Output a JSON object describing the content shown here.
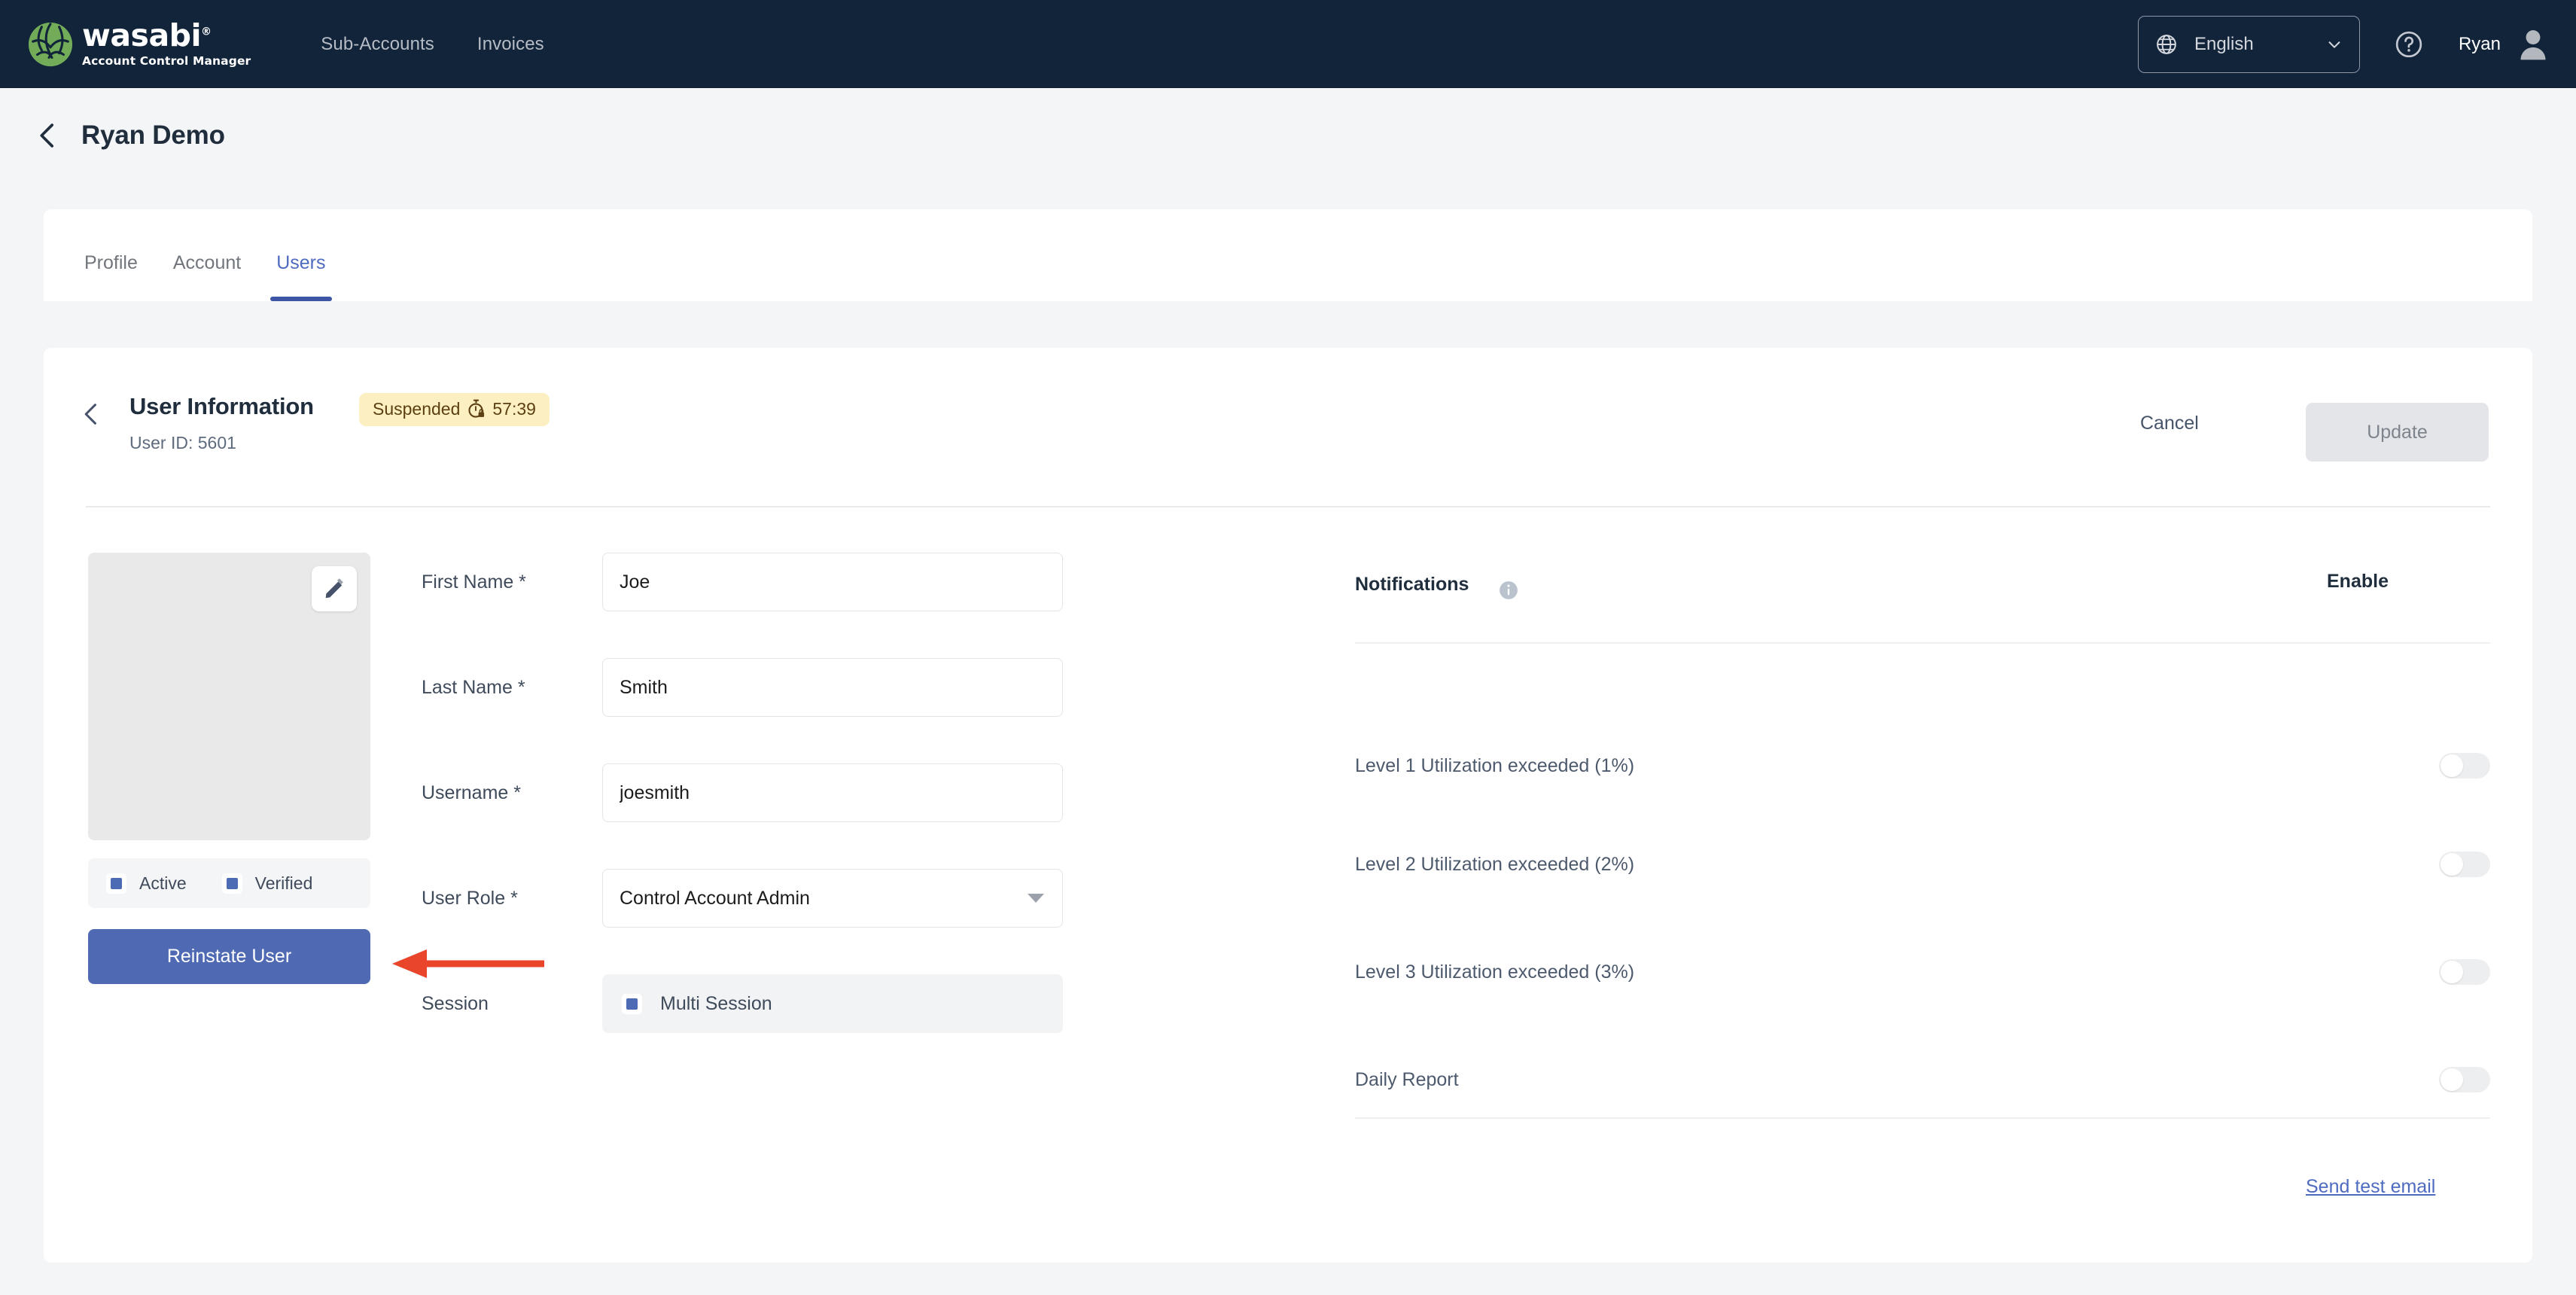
{
  "topnav": {
    "brand_word": "wasabi",
    "brand_sub": "Account Control Manager",
    "links": [
      {
        "label": "Sub-Accounts"
      },
      {
        "label": "Invoices"
      }
    ],
    "language": "English",
    "user_name": "Ryan",
    "icons": {
      "globe": "globe-icon",
      "chevron_down": "chevron-down-icon",
      "help": "help-circle-icon",
      "avatar": "user-avatar-icon"
    },
    "colors": {
      "bar_bg": "#12243a",
      "logo_green": "#72ac58"
    }
  },
  "breadcrumb": {
    "back_icon": "chevron-left-icon",
    "title": "Ryan Demo"
  },
  "tabs": [
    {
      "label": "Profile",
      "active": false
    },
    {
      "label": "Account",
      "active": false
    },
    {
      "label": "Users",
      "active": true
    }
  ],
  "user_info": {
    "back_icon": "chevron-left-icon",
    "title": "User Information",
    "user_id": "User ID: 5601",
    "status_badge": {
      "label": "Suspended",
      "icon": "stopwatch-lock-icon",
      "timer": "57:39",
      "bg": "#fcf0c3",
      "fg": "#5c3f11"
    },
    "cancel_label": "Cancel",
    "update_label": "Update"
  },
  "avatar_panel": {
    "edit_icon": "pencil-icon",
    "statuses": [
      {
        "label": "Active",
        "checked": true
      },
      {
        "label": "Verified",
        "checked": true
      }
    ],
    "reinstate_label": "Reinstate User",
    "reinstate_color": "#4f6ab3"
  },
  "annotation": {
    "type": "arrow-left",
    "color": "#e8452a",
    "points_to": "Reinstate User"
  },
  "form": {
    "fields": [
      {
        "label": "First Name *",
        "value": "Joe",
        "type": "text",
        "placeholder": ""
      },
      {
        "label": "Last Name *",
        "value": "Smith",
        "type": "text",
        "placeholder": ""
      },
      {
        "label": "Username *",
        "value": "joesmith",
        "type": "text",
        "placeholder": ""
      },
      {
        "label": "User Role *",
        "value": "Control Account Admin",
        "type": "select",
        "placeholder": ""
      }
    ],
    "session": {
      "label": "Session",
      "option_label": "Multi Session",
      "checked": true
    }
  },
  "notifications": {
    "title": "Notifications",
    "info_icon": "info-icon",
    "enable_header": "Enable",
    "items": [
      {
        "label": "Level 1 Utilization exceeded (1%)",
        "enabled": false
      },
      {
        "label": "Level 2 Utilization exceeded (2%)",
        "enabled": false
      },
      {
        "label": "Level 3 Utilization exceeded (3%)",
        "enabled": false
      },
      {
        "label": "Daily Report",
        "enabled": false
      }
    ],
    "send_test_label": "Send test email"
  }
}
